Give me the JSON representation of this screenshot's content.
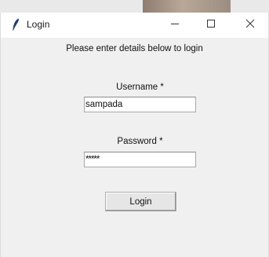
{
  "window": {
    "title": "Login",
    "icon": "feather-icon",
    "controls": {
      "minimize": "minimize-icon",
      "maximize": "maximize-icon",
      "close": "close-icon"
    }
  },
  "form": {
    "prompt": "Please enter details below to login",
    "username": {
      "label": "Username *",
      "value": "sampada"
    },
    "password": {
      "label": "Password *",
      "value": "*****"
    },
    "login_button": "Login"
  },
  "colors": {
    "titlebar": "#ffffff",
    "window_bg": "#f0f0f0",
    "field_bg": "#ffffff",
    "button_bg": "#e6e6e6"
  }
}
